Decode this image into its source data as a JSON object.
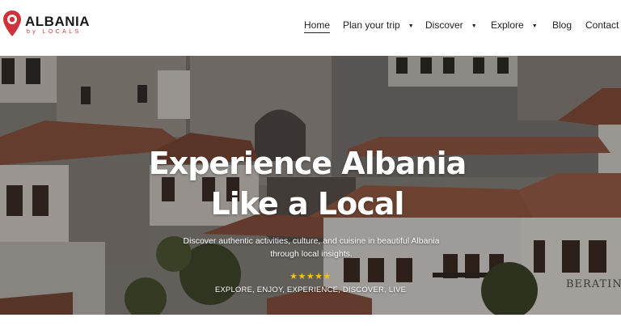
{
  "brand": {
    "name": "ALBANIA",
    "tagline": "by LOCALS",
    "accent_color": "#d0323b",
    "icon": "map-pin-icon"
  },
  "nav": {
    "items": [
      {
        "label": "Home",
        "active": true,
        "has_dropdown": false
      },
      {
        "label": "Plan your trip",
        "active": false,
        "has_dropdown": true
      },
      {
        "label": "Discover",
        "active": false,
        "has_dropdown": true
      },
      {
        "label": "Explore",
        "active": false,
        "has_dropdown": true
      },
      {
        "label": "Blog",
        "active": false,
        "has_dropdown": false
      },
      {
        "label": "Contact",
        "active": false,
        "has_dropdown": false
      }
    ],
    "dropdown_icon": "caret-down-icon",
    "dropdown_glyph": "▼"
  },
  "hero": {
    "title": "Experience Albania Like a Local",
    "subtitle": "Discover authentic activities, culture, and cuisine in beautiful Albania through local insights.",
    "rating_glyphs": "★★★★★",
    "rating": 5,
    "tagline": "EXPLORE, ENJOY, EXPERIENCE, DISCOVER, LIVE",
    "background": "Berat stone houses photo",
    "sign_text": "BERATINO"
  }
}
